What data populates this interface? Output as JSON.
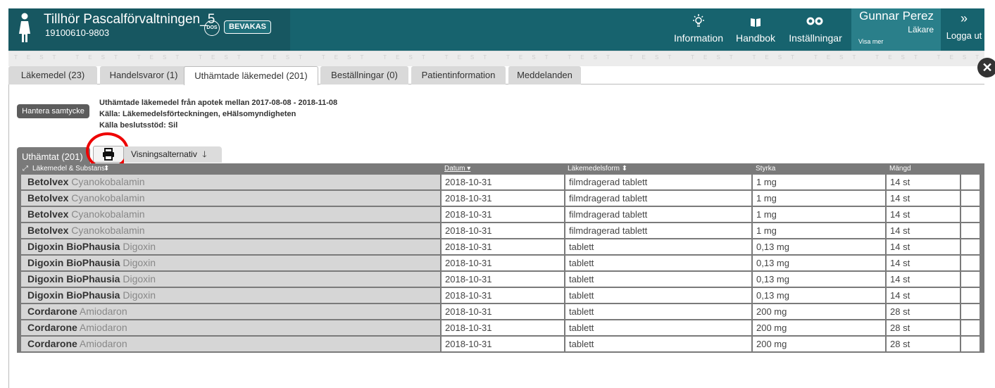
{
  "header": {
    "patient_name": "Tillhör Pascalförvaltningen_5",
    "patient_number": "19100610-9803",
    "dos_badge": "DOS",
    "bevakas_badge": "BEVAKAS",
    "nav": [
      {
        "label": "Information",
        "icon": "lightbulb-icon"
      },
      {
        "label": "Handbok",
        "icon": "book-icon"
      },
      {
        "label": "Inställningar",
        "icon": "gears-icon"
      }
    ],
    "user_name": "Gunnar Perez",
    "user_role": "Läkare",
    "user_more": "Visa mer",
    "logout_label": "Logga ut",
    "colors": {
      "bar": "#17636e",
      "patient": "#175761",
      "user": "#2a7f8a"
    }
  },
  "watermark": "TEST TEST TEST TEST TEST TEST TEST TEST TEST TEST TEST TEST TEST TEST TEST TEST TEST TEST TEST TEST TEST TEST TEST TEST TEST TEST TEST TEST TEST TEST TEST TEST TEST TEST TEST TEST TEST TEST TEST TEST TEST TEST",
  "tabs": [
    {
      "label": "Läkemedel (23)",
      "active": false
    },
    {
      "label": "Handelsvaror (1)",
      "active": false
    },
    {
      "label": "Uthämtade läkemedel (201)",
      "active": true
    },
    {
      "label": "Beställningar (0)",
      "active": false
    },
    {
      "label": "Patientinformation",
      "active": false
    },
    {
      "label": "Meddelanden",
      "active": false
    }
  ],
  "consent_button": "Hantera samtycke",
  "info_lines": {
    "line1": "Uthämtade läkemedel från apotek mellan 2017-08-08 - 2018-11-08",
    "line2": "Källa: Läkemedelsförteckningen, eHälsomyndigheten",
    "line3": "Källa beslutsstöd: Sil"
  },
  "section": {
    "title": "Uthämtat (201)",
    "print_icon": "printer-icon",
    "options_label": "Visningsalternativ"
  },
  "table": {
    "headers": {
      "name": "Läkemedel & Substans",
      "date": "Datum",
      "form": "Läkemedelsform",
      "strength": "Styrka",
      "amount": "Mängd"
    },
    "rows": [
      {
        "brand": "Betolvex",
        "substance": "Cyanokobalamin",
        "date": "2018-10-31",
        "form": "filmdragerad tablett",
        "strength": "1 mg",
        "amount": "14 st"
      },
      {
        "brand": "Betolvex",
        "substance": "Cyanokobalamin",
        "date": "2018-10-31",
        "form": "filmdragerad tablett",
        "strength": "1 mg",
        "amount": "14 st"
      },
      {
        "brand": "Betolvex",
        "substance": "Cyanokobalamin",
        "date": "2018-10-31",
        "form": "filmdragerad tablett",
        "strength": "1 mg",
        "amount": "14 st"
      },
      {
        "brand": "Betolvex",
        "substance": "Cyanokobalamin",
        "date": "2018-10-31",
        "form": "filmdragerad tablett",
        "strength": "1 mg",
        "amount": "14 st"
      },
      {
        "brand": "Digoxin BioPhausia",
        "substance": "Digoxin",
        "date": "2018-10-31",
        "form": "tablett",
        "strength": "0,13 mg",
        "amount": "14 st"
      },
      {
        "brand": "Digoxin BioPhausia",
        "substance": "Digoxin",
        "date": "2018-10-31",
        "form": "tablett",
        "strength": "0,13 mg",
        "amount": "14 st"
      },
      {
        "brand": "Digoxin BioPhausia",
        "substance": "Digoxin",
        "date": "2018-10-31",
        "form": "tablett",
        "strength": "0,13 mg",
        "amount": "14 st"
      },
      {
        "brand": "Digoxin BioPhausia",
        "substance": "Digoxin",
        "date": "2018-10-31",
        "form": "tablett",
        "strength": "0,13 mg",
        "amount": "14 st"
      },
      {
        "brand": "Cordarone",
        "substance": "Amiodaron",
        "date": "2018-10-31",
        "form": "tablett",
        "strength": "200 mg",
        "amount": "28 st"
      },
      {
        "brand": "Cordarone",
        "substance": "Amiodaron",
        "date": "2018-10-31",
        "form": "tablett",
        "strength": "200 mg",
        "amount": "28 st"
      },
      {
        "brand": "Cordarone",
        "substance": "Amiodaron",
        "date": "2018-10-31",
        "form": "tablett",
        "strength": "200 mg",
        "amount": "28 st"
      }
    ]
  }
}
